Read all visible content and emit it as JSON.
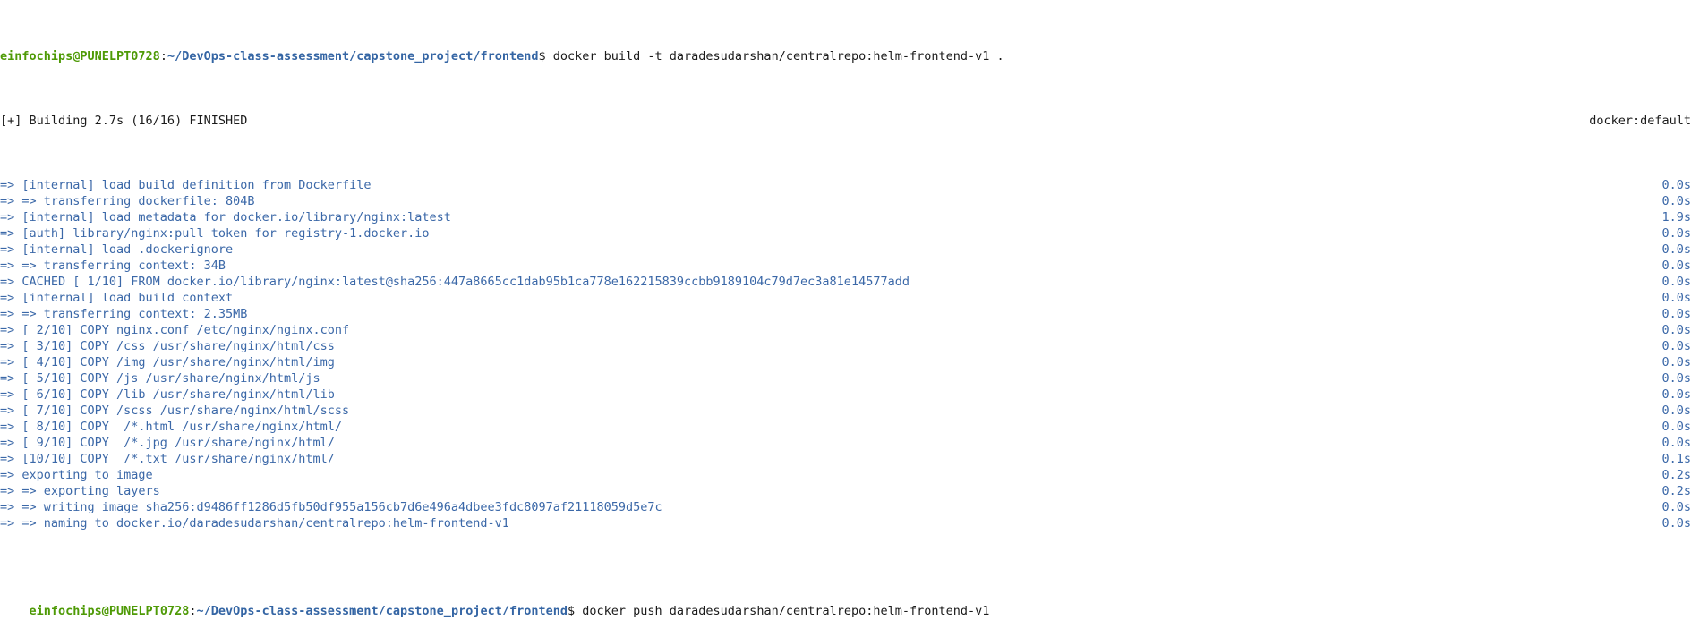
{
  "prompt1": {
    "user_host": "einfochips@PUNELPT0728",
    "colon": ":",
    "path": "~/DevOps-class-assessment/capstone_project/frontend",
    "symbol": "$ ",
    "command": "docker build -t daradesudarshan/centralrepo:helm-frontend-v1 ."
  },
  "build_header": {
    "text": "[+] Building 2.7s (16/16) FINISHED",
    "context": "docker:default"
  },
  "steps": [
    {
      "text": "=> [internal] load build definition from Dockerfile",
      "time": "0.0s"
    },
    {
      "text": "=> => transferring dockerfile: 804B",
      "time": "0.0s"
    },
    {
      "text": "=> [internal] load metadata for docker.io/library/nginx:latest",
      "time": "1.9s"
    },
    {
      "text": "=> [auth] library/nginx:pull token for registry-1.docker.io",
      "time": "0.0s"
    },
    {
      "text": "=> [internal] load .dockerignore",
      "time": "0.0s"
    },
    {
      "text": "=> => transferring context: 34B",
      "time": "0.0s"
    },
    {
      "text": "=> CACHED [ 1/10] FROM docker.io/library/nginx:latest@sha256:447a8665cc1dab95b1ca778e162215839ccbb9189104c79d7ec3a81e14577add",
      "time": "0.0s"
    },
    {
      "text": "=> [internal] load build context",
      "time": "0.0s"
    },
    {
      "text": "=> => transferring context: 2.35MB",
      "time": "0.0s"
    },
    {
      "text": "=> [ 2/10] COPY nginx.conf /etc/nginx/nginx.conf",
      "time": "0.0s"
    },
    {
      "text": "=> [ 3/10] COPY /css /usr/share/nginx/html/css",
      "time": "0.0s"
    },
    {
      "text": "=> [ 4/10] COPY /img /usr/share/nginx/html/img",
      "time": "0.0s"
    },
    {
      "text": "=> [ 5/10] COPY /js /usr/share/nginx/html/js",
      "time": "0.0s"
    },
    {
      "text": "=> [ 6/10] COPY /lib /usr/share/nginx/html/lib",
      "time": "0.0s"
    },
    {
      "text": "=> [ 7/10] COPY /scss /usr/share/nginx/html/scss",
      "time": "0.0s"
    },
    {
      "text": "=> [ 8/10] COPY  /*.html /usr/share/nginx/html/",
      "time": "0.0s"
    },
    {
      "text": "=> [ 9/10] COPY  /*.jpg /usr/share/nginx/html/",
      "time": "0.0s"
    },
    {
      "text": "=> [10/10] COPY  /*.txt /usr/share/nginx/html/",
      "time": "0.1s"
    },
    {
      "text": "=> exporting to image",
      "time": "0.2s"
    },
    {
      "text": "=> => exporting layers",
      "time": "0.2s"
    },
    {
      "text": "=> => writing image sha256:d9486ff1286d5fb50df955a156cb7d6e496a4dbee3fdc8097af21118059d5e7c",
      "time": "0.0s"
    },
    {
      "text": "=> => naming to docker.io/daradesudarshan/centralrepo:helm-frontend-v1",
      "time": "0.0s"
    }
  ],
  "prompt2": {
    "user_host": "einfochips@PUNELPT0728",
    "colon": ":",
    "path": "~/DevOps-class-assessment/capstone_project/frontend",
    "symbol": "$ ",
    "command": "docker push daradesudarshan/centralrepo:helm-frontend-v1"
  }
}
